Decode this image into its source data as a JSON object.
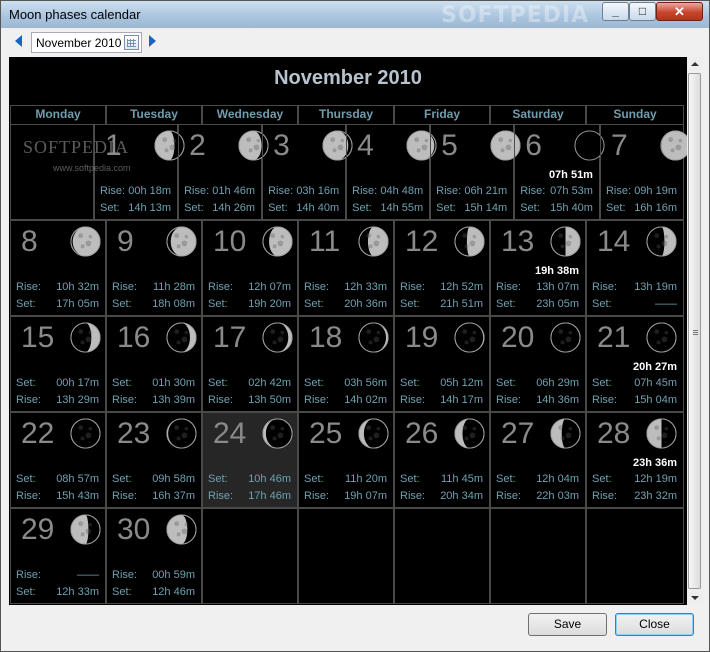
{
  "window": {
    "title": "Moon phases calendar",
    "watermark": "SOFTPEDIA",
    "min_glyph": "_",
    "max_glyph": "□",
    "close_glyph": "✕"
  },
  "nav": {
    "prev_icon": "arrow-left-icon",
    "next_icon": "arrow-right-icon",
    "date_value": "November 2010",
    "calendar_icon": "calendar-icon"
  },
  "calendar": {
    "title": "November 2010",
    "weekdays": [
      "Monday",
      "Tuesday",
      "Wednesday",
      "Thursday",
      "Friday",
      "Saturday",
      "Sunday"
    ],
    "watermark": "SOFTPEDIA",
    "watermark_url": "www.softpedia.com",
    "colors": {
      "background": "#000000",
      "grid": "#4a4a4a",
      "label": "#6fa0b0",
      "daynum": "#8a8a8a",
      "event": "#ffffff",
      "heading": "#b7c2cc",
      "moon_lit": "#bdbdbd"
    },
    "weeks": [
      [
        null,
        {
          "day": "1",
          "phase": 0.33,
          "waning": true,
          "r1": {
            "l": "Rise:",
            "v": "00h 18m"
          },
          "r2": {
            "l": "Set:",
            "v": "14h 13m"
          }
        },
        {
          "day": "2",
          "phase": 0.22,
          "waning": true,
          "r1": {
            "l": "Rise:",
            "v": "01h 46m"
          },
          "r2": {
            "l": "Set:",
            "v": "14h 26m"
          }
        },
        {
          "day": "3",
          "phase": 0.13,
          "waning": true,
          "r1": {
            "l": "Rise:",
            "v": "03h 16m"
          },
          "r2": {
            "l": "Set:",
            "v": "14h 40m"
          }
        },
        {
          "day": "4",
          "phase": 0.06,
          "waning": true,
          "r1": {
            "l": "Rise:",
            "v": "04h 48m"
          },
          "r2": {
            "l": "Set:",
            "v": "14h 55m"
          }
        },
        {
          "day": "5",
          "phase": 0.01,
          "waning": true,
          "r1": {
            "l": "Rise:",
            "v": "06h 21m"
          },
          "r2": {
            "l": "Set:",
            "v": "15h 14m"
          }
        },
        {
          "day": "6",
          "phase": 0.0,
          "waning": false,
          "event": "07h 51m",
          "r1": {
            "l": "Rise:",
            "v": "07h 53m"
          },
          "r2": {
            "l": "Set:",
            "v": "15h 40m"
          }
        },
        {
          "day": "7",
          "phase": 0.02,
          "waning": false,
          "r1": {
            "l": "Rise:",
            "v": "09h 19m"
          },
          "r2": {
            "l": "Set:",
            "v": "16h 16m"
          }
        }
      ],
      [
        {
          "day": "8",
          "phase": 0.06,
          "waning": false,
          "r1": {
            "l": "Rise:",
            "v": "10h 32m"
          },
          "r2": {
            "l": "Set:",
            "v": "17h 05m"
          }
        },
        {
          "day": "9",
          "phase": 0.13,
          "waning": false,
          "r1": {
            "l": "Rise:",
            "v": "11h 28m"
          },
          "r2": {
            "l": "Set:",
            "v": "18h 08m"
          }
        },
        {
          "day": "10",
          "phase": 0.21,
          "waning": false,
          "r1": {
            "l": "Rise:",
            "v": "12h 07m"
          },
          "r2": {
            "l": "Set:",
            "v": "19h 20m"
          }
        },
        {
          "day": "11",
          "phase": 0.31,
          "waning": false,
          "r1": {
            "l": "Rise:",
            "v": "12h 33m"
          },
          "r2": {
            "l": "Set:",
            "v": "20h 36m"
          }
        },
        {
          "day": "12",
          "phase": 0.41,
          "waning": false,
          "r1": {
            "l": "Rise:",
            "v": "12h 52m"
          },
          "r2": {
            "l": "Set:",
            "v": "21h 51m"
          }
        },
        {
          "day": "13",
          "phase": 0.5,
          "waning": false,
          "event": "19h 38m",
          "r1": {
            "l": "Rise:",
            "v": "13h 07m"
          },
          "r2": {
            "l": "Set:",
            "v": "23h 05m"
          }
        },
        {
          "day": "14",
          "phase": 0.6,
          "waning": false,
          "r1": {
            "l": "Rise:",
            "v": "13h 19m"
          },
          "r2": {
            "l": "Set:",
            "v": "——"
          }
        }
      ],
      [
        {
          "day": "15",
          "phase": 0.7,
          "waning": false,
          "r1": {
            "l": "Set:",
            "v": "00h 17m"
          },
          "r2": {
            "l": "Rise:",
            "v": "13h 29m"
          }
        },
        {
          "day": "16",
          "phase": 0.79,
          "waning": false,
          "r1": {
            "l": "Set:",
            "v": "01h 30m"
          },
          "r2": {
            "l": "Rise:",
            "v": "13h 39m"
          }
        },
        {
          "day": "17",
          "phase": 0.87,
          "waning": false,
          "r1": {
            "l": "Set:",
            "v": "02h 42m"
          },
          "r2": {
            "l": "Rise:",
            "v": "13h 50m"
          }
        },
        {
          "day": "18",
          "phase": 0.93,
          "waning": false,
          "r1": {
            "l": "Set:",
            "v": "03h 56m"
          },
          "r2": {
            "l": "Rise:",
            "v": "14h 02m"
          }
        },
        {
          "day": "19",
          "phase": 0.97,
          "waning": false,
          "r1": {
            "l": "Set:",
            "v": "05h 12m"
          },
          "r2": {
            "l": "Rise:",
            "v": "14h 17m"
          }
        },
        {
          "day": "20",
          "phase": 0.99,
          "waning": false,
          "r1": {
            "l": "Set:",
            "v": "06h 29m"
          },
          "r2": {
            "l": "Rise:",
            "v": "14h 36m"
          }
        },
        {
          "day": "21",
          "phase": 1.0,
          "waning": false,
          "event": "20h 27m",
          "r1": {
            "l": "Set:",
            "v": "07h 45m"
          },
          "r2": {
            "l": "Rise:",
            "v": "15h 04m"
          }
        }
      ],
      [
        {
          "day": "22",
          "phase": 0.99,
          "waning": true,
          "r1": {
            "l": "Set:",
            "v": "08h 57m"
          },
          "r2": {
            "l": "Rise:",
            "v": "15h 43m"
          }
        },
        {
          "day": "23",
          "phase": 0.96,
          "waning": true,
          "r1": {
            "l": "Set:",
            "v": "09h 58m"
          },
          "r2": {
            "l": "Rise:",
            "v": "16h 37m"
          }
        },
        {
          "day": "24",
          "phase": 0.9,
          "waning": true,
          "today": true,
          "r1": {
            "l": "Set:",
            "v": "10h 46m"
          },
          "r2": {
            "l": "Rise:",
            "v": "17h 46m"
          }
        },
        {
          "day": "25",
          "phase": 0.83,
          "waning": true,
          "r1": {
            "l": "Set:",
            "v": "11h 20m"
          },
          "r2": {
            "l": "Rise:",
            "v": "19h 07m"
          }
        },
        {
          "day": "26",
          "phase": 0.74,
          "waning": true,
          "r1": {
            "l": "Set:",
            "v": "11h 45m"
          },
          "r2": {
            "l": "Rise:",
            "v": "20h 34m"
          }
        },
        {
          "day": "27",
          "phase": 0.63,
          "waning": true,
          "r1": {
            "l": "Set:",
            "v": "12h 04m"
          },
          "r2": {
            "l": "Rise:",
            "v": "22h 03m"
          }
        },
        {
          "day": "28",
          "phase": 0.5,
          "waning": true,
          "event": "23h 36m",
          "r1": {
            "l": "Set:",
            "v": "12h 19m"
          },
          "r2": {
            "l": "Rise:",
            "v": "23h 32m"
          }
        }
      ],
      [
        {
          "day": "29",
          "phase": 0.4,
          "waning": true,
          "r1": {
            "l": "Rise:",
            "v": "——"
          },
          "r2": {
            "l": "Set:",
            "v": "12h 33m"
          }
        },
        {
          "day": "30",
          "phase": 0.3,
          "waning": true,
          "r1": {
            "l": "Rise:",
            "v": "00h 59m"
          },
          "r2": {
            "l": "Set:",
            "v": "12h 46m"
          }
        },
        null,
        null,
        null,
        null,
        null
      ]
    ]
  },
  "footer": {
    "save_label": "Save",
    "close_label": "Close"
  }
}
